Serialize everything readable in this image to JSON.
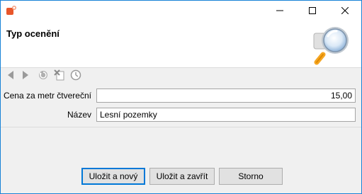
{
  "window": {
    "icon": "app-icon",
    "controls": [
      "minimize-icon",
      "maximize-icon",
      "close-icon"
    ]
  },
  "header": {
    "title": "Typ ocenění",
    "icon": "magnifier-icon"
  },
  "toolbar": {
    "items": [
      "back-arrow-icon",
      "forward-arrow-icon",
      "refresh-icon",
      "delete-icon",
      "history-icon"
    ]
  },
  "form": {
    "price_label": "Cena za metr čtvereční",
    "price_value": "15,00",
    "name_label": "Název",
    "name_value": "Lesní pozemky"
  },
  "buttons": {
    "save_new": "Uložit a nový",
    "save_close": "Uložit a zavřít",
    "cancel": "Storno"
  },
  "colors": {
    "window_border": "#1883d7",
    "accent": "#0078d7",
    "app_icon": "#e8562a"
  }
}
